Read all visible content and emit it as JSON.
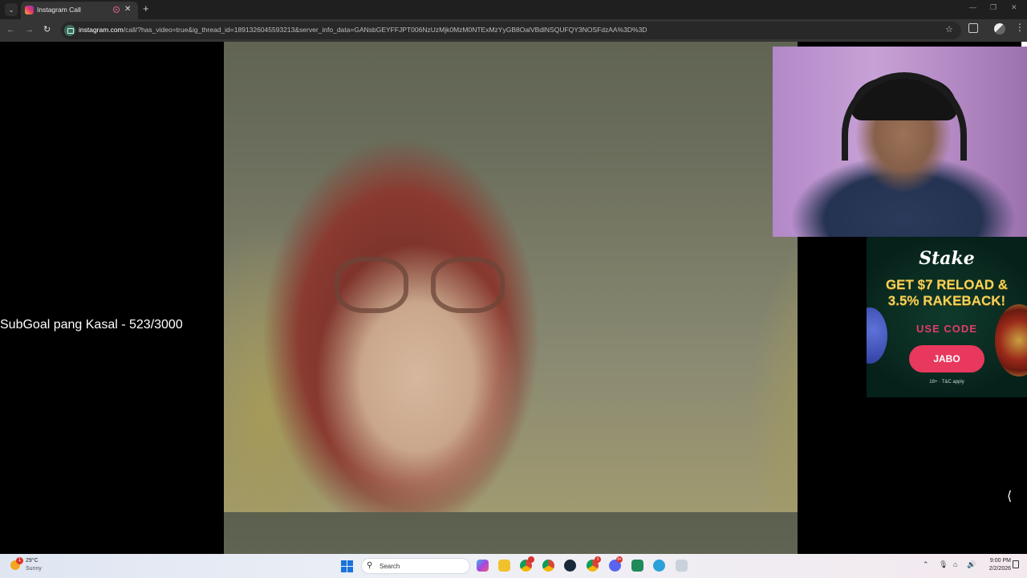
{
  "browser": {
    "tab_title": "Instagram Call",
    "tab_list_icon": "chevron-down-icon",
    "close_glyph": "✕",
    "new_tab_glyph": "+",
    "url_host": "instagram.com",
    "url_path": "/call/?has_video=true&ig_thread_id=18913260455932​13&server_info_data=GANsbGEYFFJPT006NzUzMjk0MzM0NTExMzYyGB8OalVBdlNSQUFQY3NOSFdzAA%3D%3D",
    "window_controls": [
      "—",
      "❐",
      "✕"
    ]
  },
  "overlay": {
    "sub_goal": "SubGoal pang Kasal - 523/3000"
  },
  "ad": {
    "brand": "Stake",
    "headline_line1": "GET $7 RELOAD &",
    "headline_line2": "3.5% RAKEBACK!",
    "code_label": "USE CODE",
    "code": "JABO",
    "fine_print": "18+ · T&C apply"
  },
  "taskbar": {
    "weather_temp": "29°C",
    "weather_desc": "Sunny",
    "weather_badge": "1",
    "search_placeholder": "Search",
    "clock_time": "9:00 PM",
    "clock_date": "2/2/2026",
    "pinned_badge_1": "1",
    "pinned_badge_2": "9+"
  },
  "colors": {
    "ad_accent": "#e8385e",
    "ad_headline": "#f4d35a",
    "tab_active": "#353535"
  }
}
